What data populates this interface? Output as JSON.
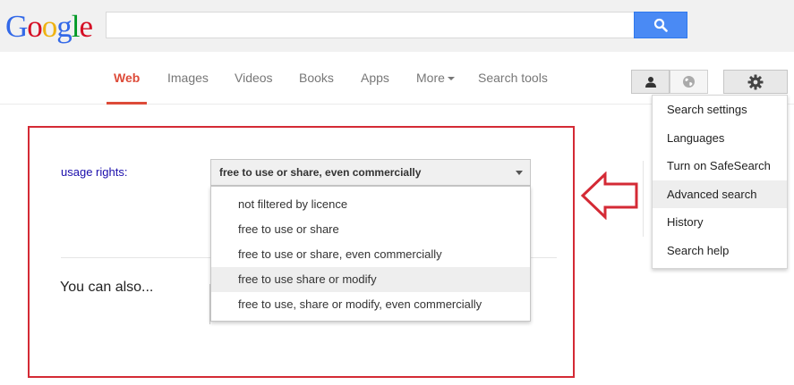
{
  "logo": {
    "letters": [
      "G",
      "o",
      "o",
      "g",
      "l",
      "e"
    ],
    "colors": [
      "#3369e8",
      "#d50f25",
      "#eeb211",
      "#3369e8",
      "#009925",
      "#d50f25"
    ]
  },
  "search": {
    "value": "",
    "placeholder": ""
  },
  "nav": {
    "tabs": [
      {
        "label": "Web",
        "active": true
      },
      {
        "label": "Images"
      },
      {
        "label": "Videos"
      },
      {
        "label": "Books"
      },
      {
        "label": "Apps"
      },
      {
        "label": "More"
      },
      {
        "label": "Search tools"
      }
    ]
  },
  "settings_menu": {
    "items": [
      {
        "label": "Search settings"
      },
      {
        "label": "Languages"
      },
      {
        "label": "Turn on SafeSearch"
      },
      {
        "label": "Advanced search",
        "hover": true
      },
      {
        "label": "History"
      },
      {
        "label": "Search help"
      }
    ]
  },
  "usage_rights": {
    "label": "usage rights:",
    "selected": "free to use or share, even commercially",
    "options": [
      "not filtered by licence",
      "free to use or share",
      "free to use or share, even commercially",
      "free to use share or modify",
      "free to use, share or modify, even commercially"
    ],
    "hover_index": 3
  },
  "also": {
    "label": "You can also..."
  },
  "colors": {
    "accent_red": "#dd4b39",
    "search_blue": "#4a8af4",
    "annotation_red": "#d42a35",
    "link_blue": "#1a0dab"
  }
}
